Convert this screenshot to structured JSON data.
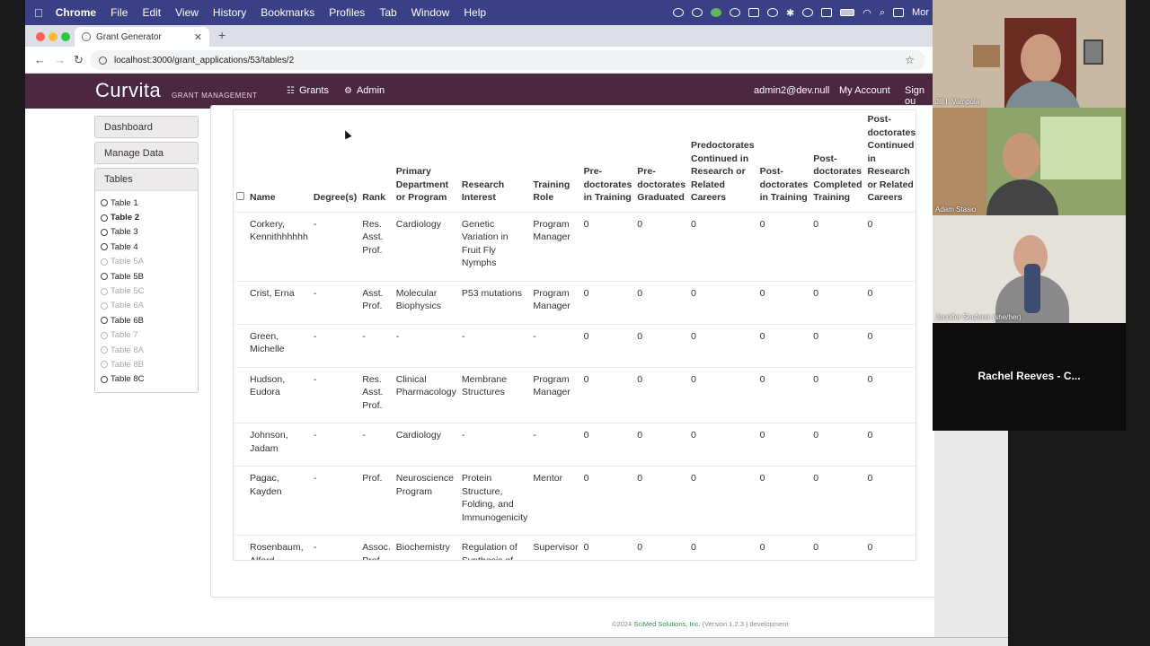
{
  "os_menu": {
    "app_name": "Chrome",
    "items": [
      "File",
      "Edit",
      "View",
      "History",
      "Bookmarks",
      "Profiles",
      "Tab",
      "Window",
      "Help"
    ],
    "status_text": "Mor"
  },
  "browser": {
    "tab_title": "Grant Generator",
    "url": "localhost:3000/grant_applications/53/tables/2"
  },
  "app_header": {
    "logo": "Curvita",
    "logo_sub": "GRANT MANAGEMENT",
    "nav_grants": "Grants",
    "nav_admin": "Admin",
    "user_email": "admin2@dev.null",
    "my_account": "My Account",
    "sign_out": "Sign ou"
  },
  "sidebar": {
    "dashboard": "Dashboard",
    "manage_data": "Manage Data",
    "tables_header": "Tables",
    "tables": [
      {
        "label": "Table 1",
        "state": "normal"
      },
      {
        "label": "Table 2",
        "state": "active"
      },
      {
        "label": "Table 3",
        "state": "normal"
      },
      {
        "label": "Table 4",
        "state": "normal"
      },
      {
        "label": "Table 5A",
        "state": "disabled"
      },
      {
        "label": "Table 5B",
        "state": "normal"
      },
      {
        "label": "Table 5C",
        "state": "disabled"
      },
      {
        "label": "Table 6A",
        "state": "disabled"
      },
      {
        "label": "Table 6B",
        "state": "normal"
      },
      {
        "label": "Table 7",
        "state": "disabled"
      },
      {
        "label": "Table 8A",
        "state": "disabled"
      },
      {
        "label": "Table 8B",
        "state": "disabled"
      },
      {
        "label": "Table 8C",
        "state": "normal"
      }
    ]
  },
  "table": {
    "columns": [
      "Name",
      "Degree(s)",
      "Rank",
      "Primary Department or Program",
      "Research Interest",
      "Training Role",
      "Pre-doctorates in Training",
      "Pre-doctorates Graduated",
      "Predoctorates Continued in Research or Related Careers",
      "Post-doctorates in Training",
      "Post-doctorates Completed Training",
      "Post-doctorates Continued in Research or Related Careers"
    ],
    "rows": [
      [
        "Corkery, Kennithhhhhh",
        "-",
        "Res. Asst. Prof.",
        "Cardiology",
        "Genetic Variation in Fruit Fly Nymphs",
        "Program Manager",
        "0",
        "0",
        "0",
        "0",
        "0",
        "0"
      ],
      [
        "Crist, Erna",
        "-",
        "Asst. Prof.",
        "Molecular Biophysics",
        "P53 mutations",
        "Program Manager",
        "0",
        "0",
        "0",
        "0",
        "0",
        "0"
      ],
      [
        "Green, Michelle",
        "-",
        "-",
        "-",
        "-",
        "-",
        "0",
        "0",
        "0",
        "0",
        "0",
        "0"
      ],
      [
        "Hudson, Eudora",
        "-",
        "Res. Asst. Prof.",
        "Clinical Pharmacology",
        "Membrane Structures",
        "Program Manager",
        "0",
        "0",
        "0",
        "0",
        "0",
        "0"
      ],
      [
        "Johnson, Jadam",
        "-",
        "-",
        "Cardiology",
        "-",
        "-",
        "0",
        "0",
        "0",
        "0",
        "0",
        "0"
      ],
      [
        "Pagac, Kayden",
        "-",
        "Prof.",
        "Neuroscience Program",
        "Protein Structure, Folding, and Immunogenicity",
        "Mentor",
        "0",
        "0",
        "0",
        "0",
        "0",
        "0"
      ],
      [
        "Rosenbaum, Alford",
        "-",
        "Assoc. Prof.",
        "Biochemistry",
        "Regulation of Synthesis of Biogenic Amines",
        "Supervisor",
        "0",
        "0",
        "0",
        "0",
        "0",
        "0"
      ]
    ]
  },
  "footer": {
    "copyright": "©2024",
    "company": "SciMed Solutions, Inc.",
    "version": "(Version 1.2.3 ) development"
  },
  "video_call": {
    "participants": [
      "Jill I. Vampola",
      "Adam Stasio",
      "Jennifer Seuferer (she/her)",
      "Rachel Reeves - C..."
    ]
  }
}
